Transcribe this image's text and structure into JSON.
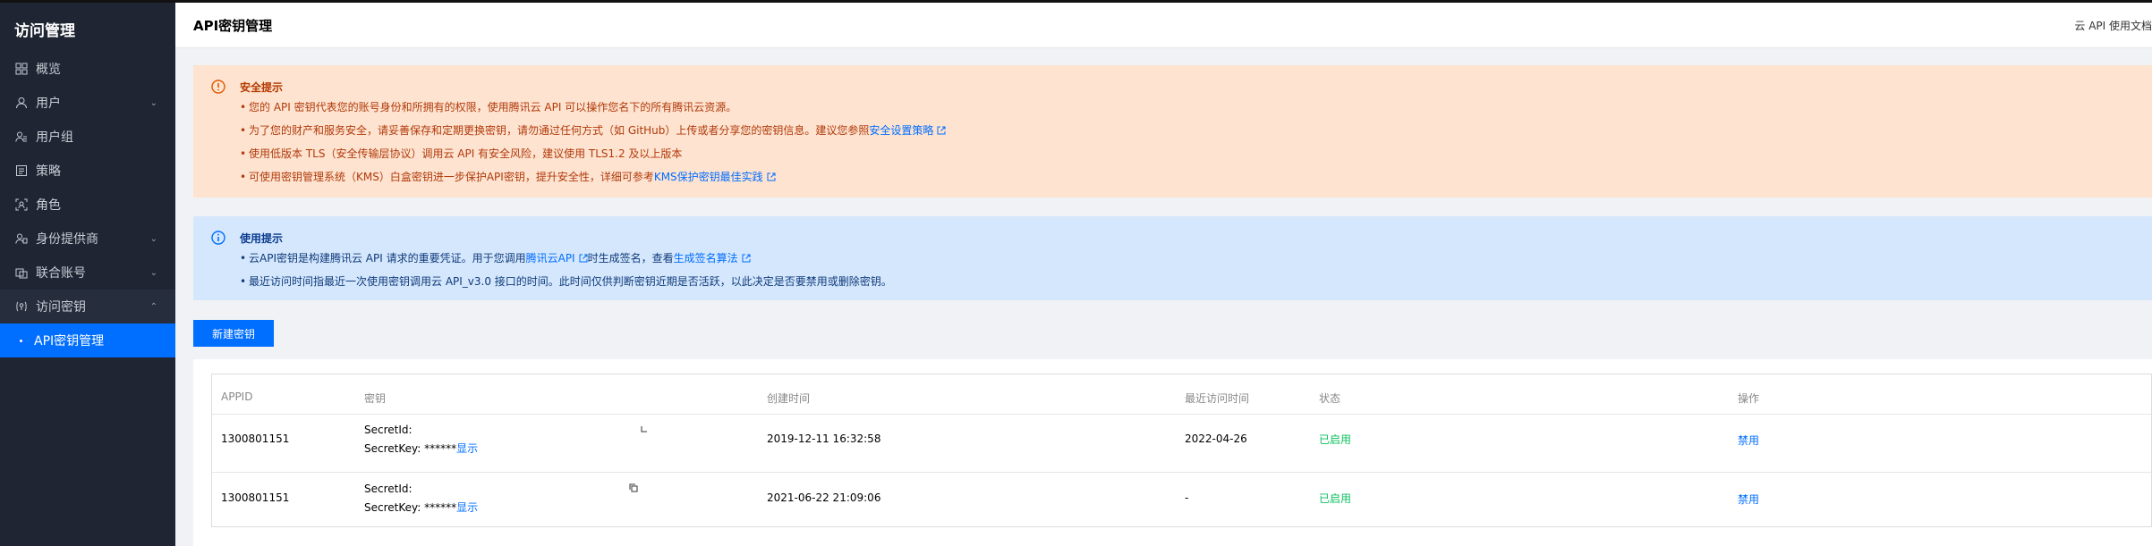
{
  "sidebar": {
    "title": "访问管理",
    "items": [
      {
        "label": "概览",
        "icon": "grid-icon"
      },
      {
        "label": "用户",
        "icon": "user-icon"
      },
      {
        "label": "用户组",
        "icon": "user-group-icon"
      },
      {
        "label": "策略",
        "icon": "policy-icon"
      },
      {
        "label": "角色",
        "icon": "role-icon"
      },
      {
        "label": "身份提供商",
        "icon": "identity-provider-icon"
      },
      {
        "label": "联合账号",
        "icon": "federated-account-icon"
      },
      {
        "label": "访问密钥",
        "icon": "key-icon"
      }
    ],
    "sub_item": "API密钥管理"
  },
  "header": {
    "title": "API密钥管理",
    "doc_link": "云 API 使用文档"
  },
  "security_alert": {
    "heading": "安全提示",
    "line1": "您的 API 密钥代表您的账号身份和所拥有的权限，使用腾讯云 API 可以操作您名下的所有腾讯云资源。",
    "line2": "为了您的财产和服务安全，请妥善保存和定期更换密钥，请勿通过任何方式（如 GitHub）上传或者分享您的密钥信息。建议您参照",
    "line2_link": "安全设置策略",
    "line3": "使用低版本 TLS（安全传输层协议）调用云 API 有安全风险，建议使用 TLS1.2 及以上版本",
    "line4": "可使用密钥管理系统（KMS）白盒密钥进一步保护API密钥，提升安全性，详细可参考",
    "line4_link": "KMS保护密钥最佳实践"
  },
  "usage_alert": {
    "heading": "使用提示",
    "line1_a": "云API密钥是构建腾讯云 API 请求的重要凭证。用于您调用",
    "line1_link1": "腾讯云API",
    "line1_b": "时生成签名，查看",
    "line1_link2": "生成签名算法",
    "line2": "最近访问时间指最近一次使用密钥调用云 API_v3.0 接口的时间。此时间仅供判断密钥近期是否活跃，以此决定是否要禁用或删除密钥。"
  },
  "new_key_button": "新建密钥",
  "table": {
    "headers": [
      "APPID",
      "密钥",
      "创建时间",
      "最近访问时间",
      "状态",
      "操作"
    ],
    "rows": [
      {
        "appid": "1300801151",
        "secret_id_label": "SecretId:",
        "secret_key_label": "SecretKey: ******",
        "show": "显示",
        "created": "2019-12-11 16:32:58",
        "last_access": "2022-04-26",
        "status": "已启用",
        "action": "禁用"
      },
      {
        "appid": "1300801151",
        "secret_id_label": "SecretId:",
        "secret_key_label": "SecretKey: ******",
        "show": "显示",
        "created": "2021-06-22 21:09:06",
        "last_access": "-",
        "status": "已启用",
        "action": "禁用"
      }
    ]
  },
  "colors": {
    "sidebar_bg": "#1f2533",
    "accent": "#006eff",
    "warning_bg": "#fde3d0",
    "info_bg": "#d5e7fd",
    "status_green": "#0abf5b"
  }
}
